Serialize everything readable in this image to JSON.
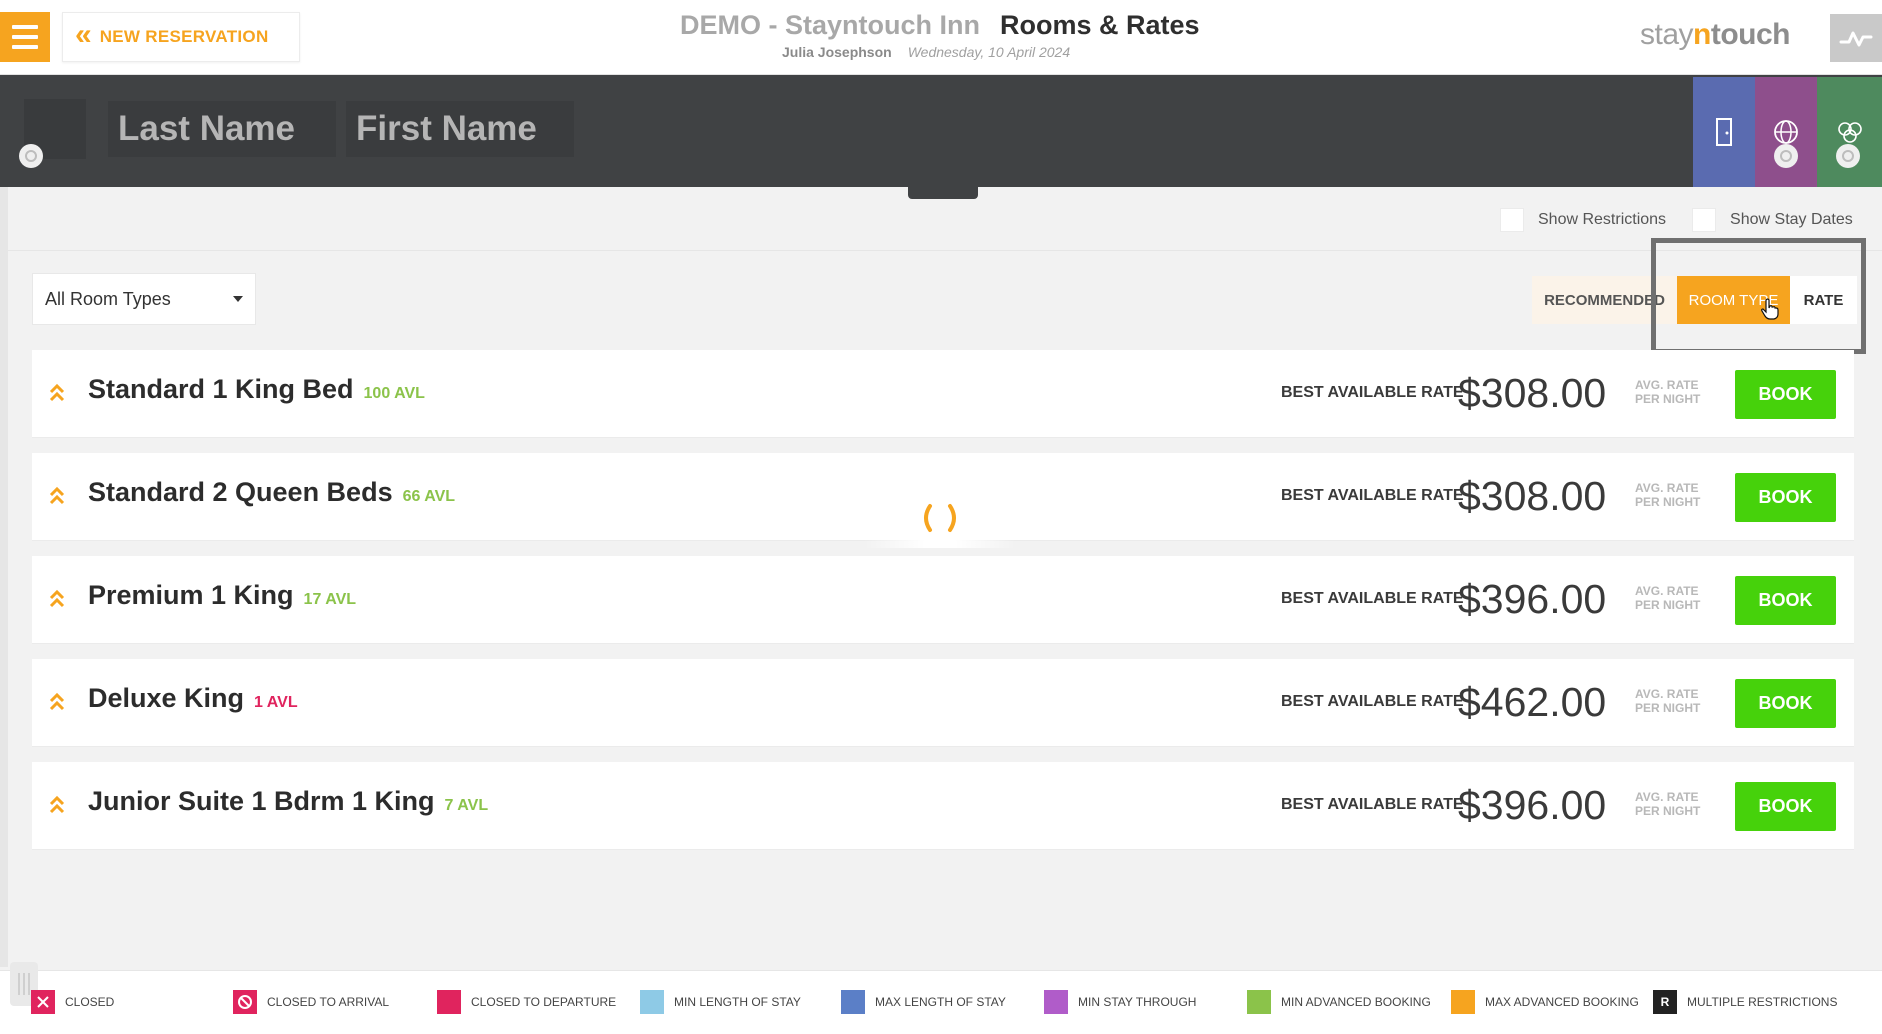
{
  "header": {
    "back_label": "NEW RESERVATION",
    "hotel_name": "DEMO - Stayntouch Inn",
    "page_title": "Rooms & Rates",
    "user_name": "Julia Josephson",
    "business_date": "Wednesday, 10 April 2024",
    "logo": {
      "part1": "stay",
      "part2": "n",
      "part3": "touch"
    }
  },
  "search": {
    "last_name_placeholder": "Last Name",
    "first_name_placeholder": "First Name"
  },
  "options": {
    "show_restrictions": "Show Restrictions",
    "show_stay_dates": "Show Stay Dates"
  },
  "filter": {
    "room_type_selected": "All Room Types"
  },
  "view_toggle": {
    "recommended": "RECOMMENDED",
    "room_type": "ROOM TYPE",
    "rate": "RATE",
    "active": "ROOM TYPE"
  },
  "rooms": [
    {
      "name": "Standard 1 King Bed",
      "availability": "100 AVL",
      "avl_color": "#8bc34a",
      "rate_label": "BEST AVAILABLE RATE",
      "price": "$308.00",
      "avg_line1": "AVG. RATE",
      "avg_line2": "PER NIGHT",
      "book_label": "BOOK"
    },
    {
      "name": "Standard 2 Queen Beds",
      "availability": "66 AVL",
      "avl_color": "#8bc34a",
      "rate_label": "BEST AVAILABLE RATE",
      "price": "$308.00",
      "avg_line1": "AVG. RATE",
      "avg_line2": "PER NIGHT",
      "book_label": "BOOK"
    },
    {
      "name": "Premium 1 King",
      "availability": "17 AVL",
      "avl_color": "#8bc34a",
      "rate_label": "BEST AVAILABLE RATE",
      "price": "$396.00",
      "avg_line1": "AVG. RATE",
      "avg_line2": "PER NIGHT",
      "book_label": "BOOK"
    },
    {
      "name": "Deluxe King",
      "availability": "1 AVL",
      "avl_color": "#e0245e",
      "rate_label": "BEST AVAILABLE RATE",
      "price": "$462.00",
      "avg_line1": "AVG. RATE",
      "avg_line2": "PER NIGHT",
      "book_label": "BOOK"
    },
    {
      "name": "Junior Suite 1 Bdrm 1 King",
      "availability": "7 AVL",
      "avl_color": "#8bc34a",
      "rate_label": "BEST AVAILABLE RATE",
      "price": "$396.00",
      "avg_line1": "AVG. RATE",
      "avg_line2": "PER NIGHT",
      "book_label": "BOOK"
    }
  ],
  "legend": [
    {
      "label": "CLOSED",
      "color": "#e0245e",
      "icon": "x-icon"
    },
    {
      "label": "CLOSED TO ARRIVAL",
      "color": "#e0245e",
      "icon": "no-entry-icon"
    },
    {
      "label": "CLOSED TO DEPARTURE",
      "color": "#e0245e",
      "icon": ""
    },
    {
      "label": "MIN LENGTH OF STAY",
      "color": "#8ecae6",
      "icon": ""
    },
    {
      "label": "MAX LENGTH OF STAY",
      "color": "#5b7fc7",
      "icon": ""
    },
    {
      "label": "MIN STAY THROUGH",
      "color": "#b05cc9",
      "icon": ""
    },
    {
      "label": "MIN ADVANCED BOOKING",
      "color": "#8bc34a",
      "icon": ""
    },
    {
      "label": "MAX ADVANCED BOOKING",
      "color": "#f6a41f",
      "icon": ""
    },
    {
      "label": "MULTIPLE RESTRICTIONS",
      "color": "#222222",
      "icon": "R"
    }
  ],
  "colors": {
    "accent": "#f6a41f",
    "book_green": "#46d20b",
    "dark_bar": "#404244",
    "tab_blue": "#5a6bb0",
    "tab_purple": "#8e4f8c",
    "tab_green": "#4e8a5e"
  }
}
